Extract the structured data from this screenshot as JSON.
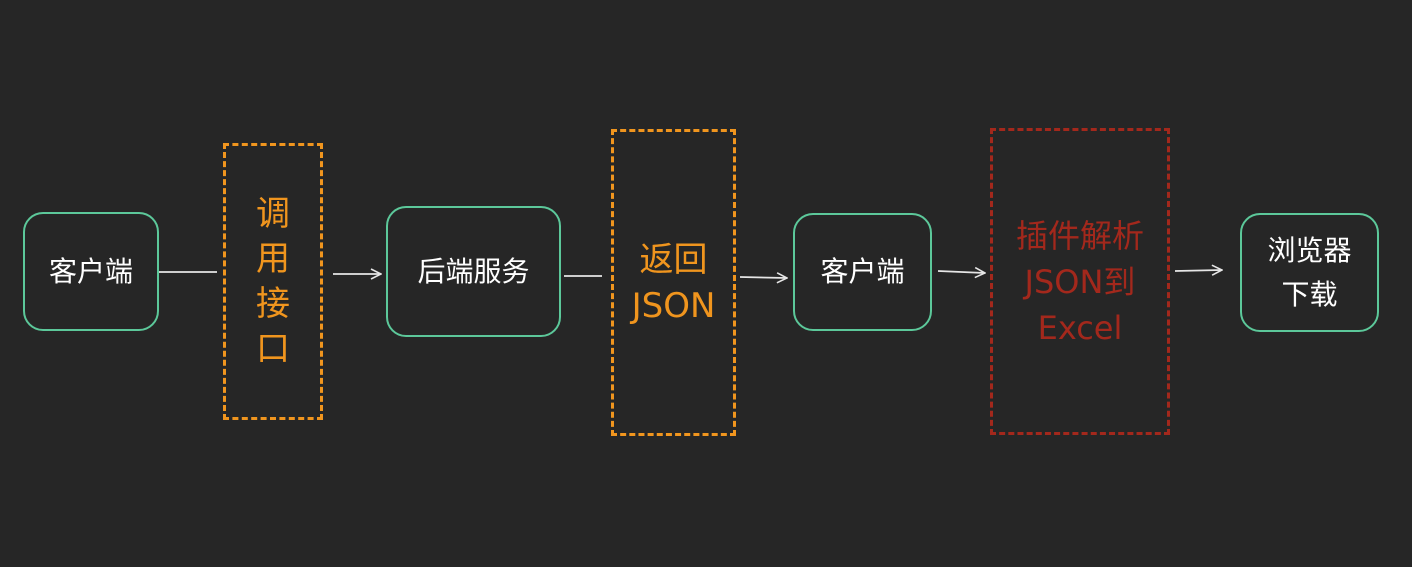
{
  "colors": {
    "background": "#262626",
    "node_border": "#5cc89a",
    "node_text": "#ffffff",
    "step_orange": "#f0951e",
    "step_red": "#a3281c",
    "connector": "#e6e6e6"
  },
  "nodes": {
    "client_1": "客户端",
    "backend": "后端服务",
    "client_2": "客户端",
    "browser_line1": "浏览器",
    "browser_line2": "下载"
  },
  "steps": {
    "call_api": [
      "调",
      "用",
      "接",
      "口"
    ],
    "return_json": [
      "返回",
      "JSON"
    ],
    "plugin_parse": [
      "插件解析",
      "JSON到",
      "Excel"
    ]
  }
}
